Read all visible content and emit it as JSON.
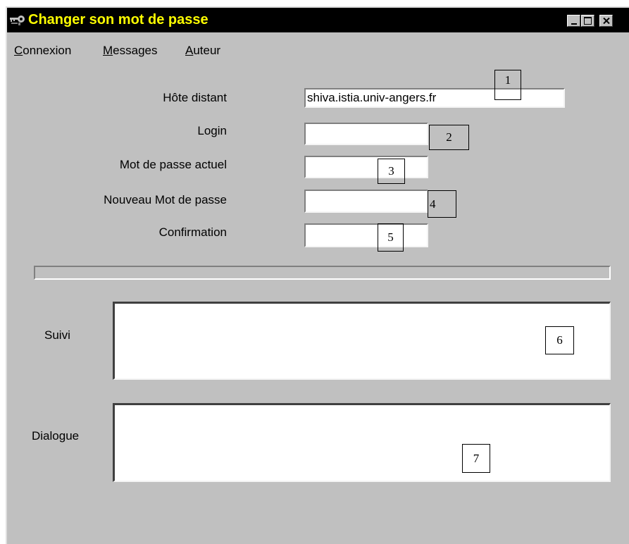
{
  "window": {
    "title": "Changer son mot de passe",
    "controls": {
      "minimize": "minimize",
      "maximize": "maximize",
      "close": "close"
    }
  },
  "menu": [
    {
      "mnemonic": "C",
      "rest": "onnexion"
    },
    {
      "mnemonic": "M",
      "rest": "essages"
    },
    {
      "mnemonic": "A",
      "rest": "uteur"
    }
  ],
  "form": {
    "host_label": "Hôte distant",
    "host_value": "shiva.istia.univ-angers.fr",
    "login_label": "Login",
    "login_value": "",
    "current_password_label": "Mot de passe actuel",
    "current_password_value": "",
    "new_password_label": "Nouveau Mot de passe",
    "new_password_value": "",
    "confirmation_label": "Confirmation",
    "confirmation_value": ""
  },
  "progress": {
    "value": 0
  },
  "suivi": {
    "label": "Suivi",
    "value": ""
  },
  "dialogue": {
    "label": "Dialogue",
    "value": ""
  },
  "callouts": [
    "1",
    "2",
    "3",
    "4",
    "5",
    "6",
    "7"
  ],
  "colors": {
    "titlebar_bg": "#000000",
    "title_text": "#ffff00",
    "window_bg": "#c0c0c0",
    "field_bg": "#ffffff"
  },
  "icons": {
    "app": "key-icon",
    "minimize": "minimize-icon",
    "maximize": "maximize-icon",
    "close": "close-icon"
  }
}
